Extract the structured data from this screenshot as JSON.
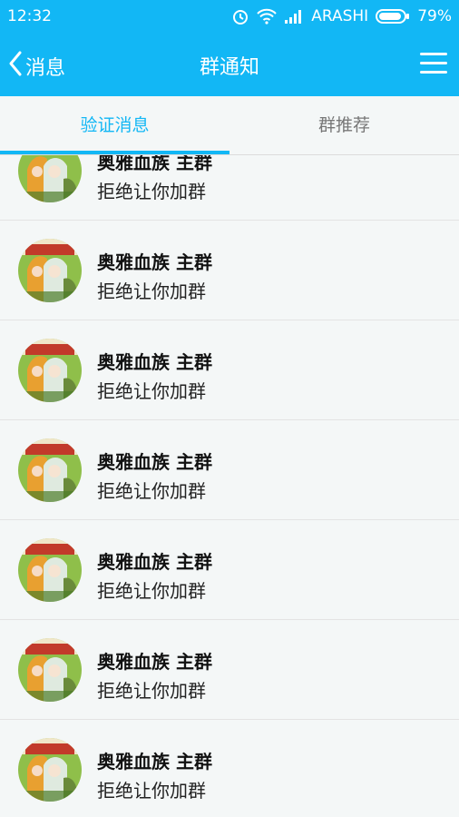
{
  "status_bar": {
    "time": "12:32",
    "carrier": "ARASHI",
    "battery": "79%",
    "icons": [
      "alarm-icon",
      "wifi-icon",
      "signal-icon",
      "battery-icon"
    ]
  },
  "header": {
    "back_label": "消息",
    "title": "群通知",
    "menu_icon": "menu-icon"
  },
  "tabs": [
    {
      "label": "验证消息",
      "active": true
    },
    {
      "label": "群推荐",
      "active": false
    }
  ],
  "notifications": [
    {
      "group_name": "奥雅血族 主群",
      "message": "拒绝让你加群"
    },
    {
      "group_name": "奥雅血族 主群",
      "message": "拒绝让你加群"
    },
    {
      "group_name": "奥雅血族 主群",
      "message": "拒绝让你加群"
    },
    {
      "group_name": "奥雅血族 主群",
      "message": "拒绝让你加群"
    },
    {
      "group_name": "奥雅血族 主群",
      "message": "拒绝让你加群"
    },
    {
      "group_name": "奥雅血族 主群",
      "message": "拒绝让你加群"
    },
    {
      "group_name": "奥雅血族 主群",
      "message": "拒绝让你加群"
    }
  ],
  "colors": {
    "accent": "#12b7f5",
    "background": "#f4f7f7"
  }
}
